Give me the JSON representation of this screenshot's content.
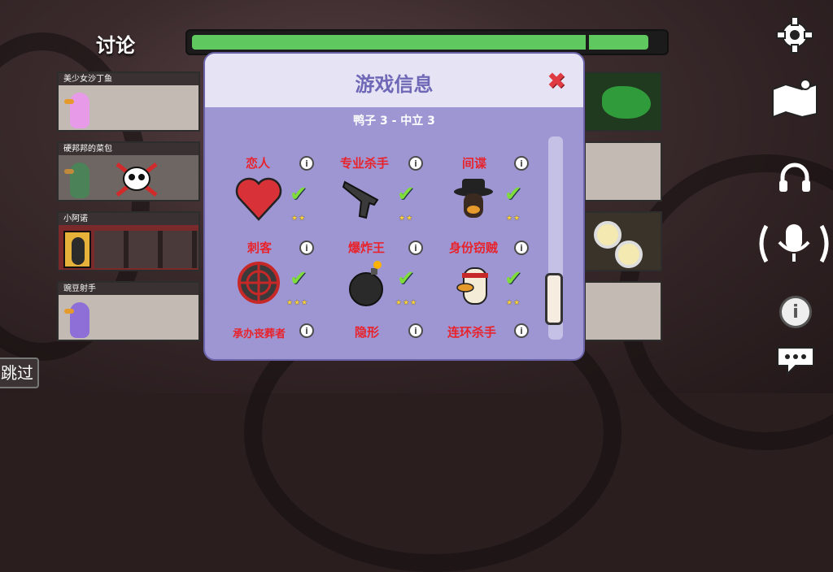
{
  "header": {
    "title": "讨论",
    "timer_progress": 0.97
  },
  "players": [
    {
      "name": "美少女沙丁鱼",
      "color": "#e79ae8",
      "dead": false
    },
    {
      "name": "硬邦邦的菜包",
      "color": "#3d8e54",
      "dead": true
    },
    {
      "name": "小阿诺",
      "color": "#2b2b2b",
      "dead": false
    },
    {
      "name": "豌豆射手",
      "color": "#8e6fd8",
      "dead": false
    }
  ],
  "skip_label": "跳过",
  "panel": {
    "title": "游戏信息",
    "subtitle": "鸭子 3 - 中立 3",
    "roles": [
      {
        "name": "恋人",
        "stars": "★★",
        "art": "heart-icon"
      },
      {
        "name": "专业杀手",
        "stars": "★★",
        "art": "pistol-icon"
      },
      {
        "name": "间谍",
        "stars": "★★",
        "art": "spy-duck-icon"
      },
      {
        "name": "刺客",
        "stars": "★★★",
        "art": "crosshair-icon"
      },
      {
        "name": "爆炸王",
        "stars": "★★★",
        "art": "bomb-icon"
      },
      {
        "name": "身份窃贼",
        "stars": "★★",
        "art": "thief-duck-icon"
      },
      {
        "name": "承办丧葬者"
      },
      {
        "name": "隐形"
      },
      {
        "name": "连环杀手"
      }
    ]
  },
  "side_icons": [
    "gear-icon",
    "map-icon",
    "headphones-icon",
    "microphone-icon",
    "info-icon",
    "chat-icon"
  ]
}
